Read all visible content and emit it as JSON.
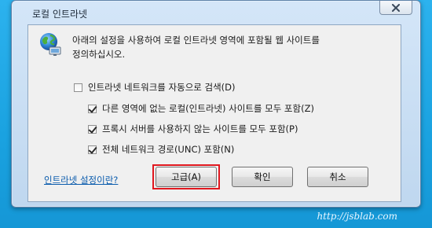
{
  "window": {
    "title": "로컬 인트라넷"
  },
  "dialog": {
    "intro_line1": "아래의 설정을 사용하여 로컬 인트라넷 영역에 포함될 웹 사이트를",
    "intro_line2": "정의하십시오.",
    "options": {
      "auto_detect": {
        "label": "인트라넷 네트워크를 자동으로 검색(D)",
        "checked": false
      },
      "include_local_sites": {
        "label": "다른 영역에 없는 로컬(인트라넷) 사이트를 모두 포함(Z)",
        "checked": true
      },
      "bypass_proxy": {
        "label": "프록시 서버를 사용하지 않는 사이트를 모두 포함(P)",
        "checked": true
      },
      "include_unc": {
        "label": "전체 네트워크 경로(UNC) 포함(N)",
        "checked": true
      }
    },
    "help_link": "인트라넷 설정이란?",
    "buttons": {
      "advanced": "고급(A)",
      "ok": "확인",
      "cancel": "취소"
    }
  },
  "watermark": "http://jsblab.com",
  "colors": {
    "desktop": "#1aa2e0",
    "highlight": "#e0181f",
    "link": "#0b5cad"
  },
  "icons": {
    "globe": "globe-network-icon",
    "close": "close-icon",
    "checkbox_check": "checkmark-icon"
  }
}
